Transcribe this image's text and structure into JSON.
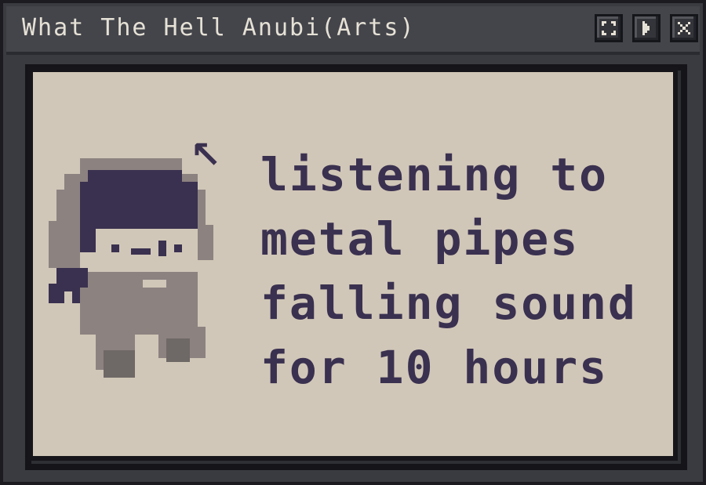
{
  "window": {
    "title": "What The Hell Anubi(Arts)",
    "buttons": {
      "maximize_icon": "maximize-icon",
      "play_icon": "play-icon",
      "close_icon": "close-icon"
    }
  },
  "content": {
    "caption_lines": [
      "listening to",
      "metal pipes",
      "falling sound",
      "for 10 hours"
    ]
  },
  "colors": {
    "window_bg": "#3a3b40",
    "canvas_bg": "#d1c7b8",
    "ink": "#3a3150",
    "character_gray": "#8c8280",
    "character_dark": "#6e6866"
  }
}
